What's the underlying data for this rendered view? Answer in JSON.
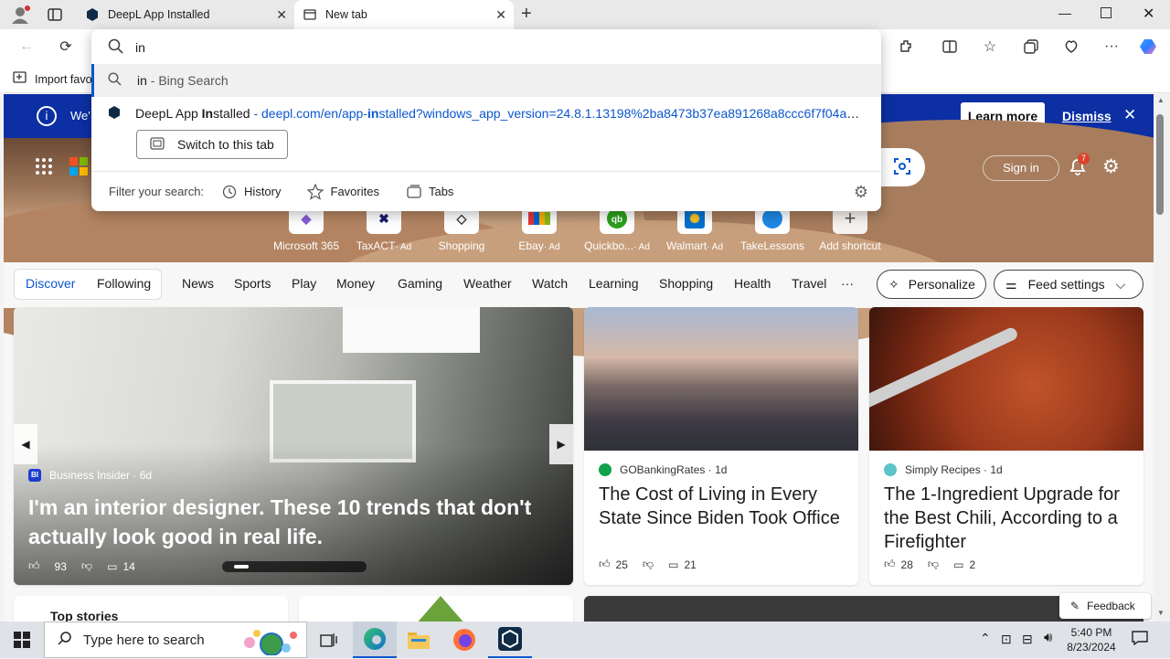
{
  "tabs": [
    {
      "title": "DeepL App Installed"
    },
    {
      "title": "New tab"
    }
  ],
  "omnibox": {
    "value": "in",
    "suggestions": [
      {
        "query": "in",
        "suffix": " - Bing Search"
      },
      {
        "title_pre": "DeepL App ",
        "title_bold": "In",
        "title_post": "stalled",
        "url_pre": " - deepl.com/en/app-",
        "url_bold": "in",
        "url_post": "stalled?windows_app_version=24.8.1.13198%2ba8473b37ea891268a8ccc6f7f04a416…"
      }
    ],
    "switch_button": "Switch to this tab",
    "filter_label": "Filter your search:",
    "filters": [
      "History",
      "Favorites",
      "Tabs"
    ]
  },
  "favorites_bar": {
    "import": "Import favo"
  },
  "infobar": {
    "text": "We'",
    "learn_more": "Learn more",
    "dismiss": "Dismiss"
  },
  "header": {
    "sign_in": "Sign in",
    "notification_count": "7"
  },
  "shortcuts": [
    {
      "label": "Microsoft 365",
      "color": "#8a5cd6"
    },
    {
      "label": "TaxACT",
      "ad": "· Ad",
      "color": "#1a1a6e"
    },
    {
      "label": "Shopping",
      "color": "#333333"
    },
    {
      "label": "Ebay",
      "ad": "· Ad",
      "color": "#e53238"
    },
    {
      "label": "Quickbo...",
      "ad": "· Ad",
      "color": "#2ca01c"
    },
    {
      "label": "Walmart",
      "ad": "· Ad",
      "color": "#0071ce"
    },
    {
      "label": "TakeLessons",
      "color": "#1e88e5"
    },
    {
      "label": "Add shortcut",
      "color": "#555555"
    }
  ],
  "feed": {
    "tabs": [
      "Discover",
      "Following"
    ],
    "categories": [
      "News",
      "Sports",
      "Play",
      "Money",
      "Gaming",
      "Weather",
      "Watch",
      "Learning",
      "Shopping",
      "Health",
      "Travel",
      "···"
    ],
    "personalize": "Personalize",
    "feed_settings": "Feed settings"
  },
  "cards": [
    {
      "source": "Business Insider",
      "age": "· 6d",
      "headline": "I'm an interior designer. These 10 trends that don't actually look good in real life.",
      "likes": "93",
      "comments": "14"
    },
    {
      "source": "GOBankingRates",
      "age": "· 1d",
      "headline": "The Cost of Living in Every State Since Biden Took Office",
      "likes": "25",
      "comments": "21"
    },
    {
      "source": "Simply Recipes",
      "age": "· 1d",
      "headline": "The 1-Ingredient Upgrade for the Best Chili, According to a Firefighter",
      "likes": "28",
      "comments": "2"
    }
  ],
  "bottom": {
    "top_stories": "Top stories",
    "feedback": "Feedback"
  },
  "taskbar": {
    "search_placeholder": "Type here to search",
    "time": "5:40 PM",
    "date": "8/23/2024"
  },
  "colors": {
    "accent": "#0b57d0",
    "infobar": "#0c2fa3"
  }
}
